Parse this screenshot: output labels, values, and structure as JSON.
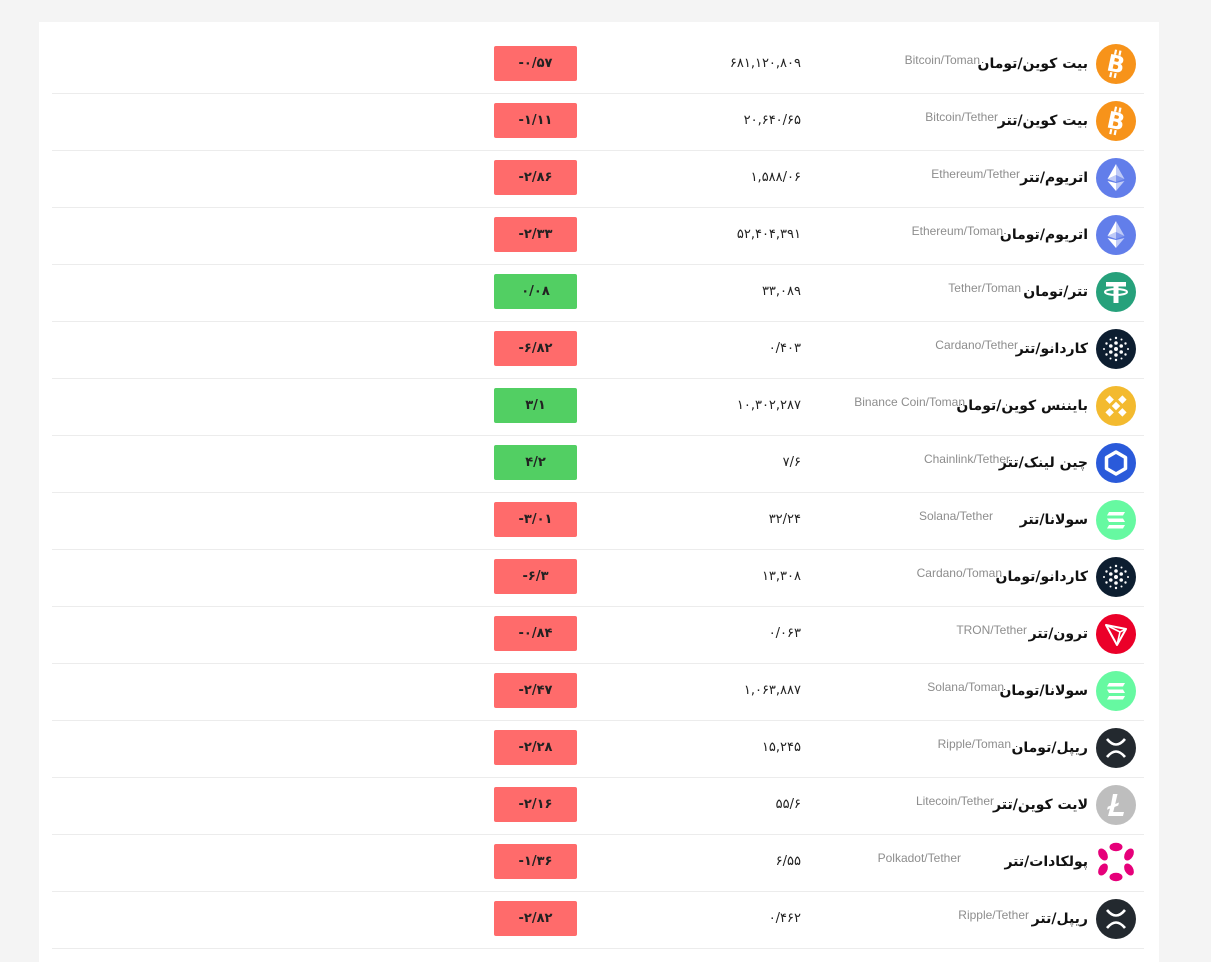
{
  "colors": {
    "negative": "#ff6b6b",
    "positive": "#52cf63"
  },
  "rows": [
    {
      "name_fa": "بیت کوین/تومان",
      "name_en": "Bitcoin/Toman",
      "price": "۶۸۱,۱۲۰,۸۰۹",
      "change": "-۰/۵۷",
      "direction": "down",
      "icon": "bitcoin-icon"
    },
    {
      "name_fa": "بیت کوین/تتر",
      "name_en": "Bitcoin/Tether",
      "price": "۲۰,۶۴۰/۶۵",
      "change": "-۱/۱۱",
      "direction": "down",
      "icon": "bitcoin-icon"
    },
    {
      "name_fa": "اتریوم/تتر",
      "name_en": "Ethereum/Tether",
      "price": "۱,۵۸۸/۰۶",
      "change": "-۲/۸۶",
      "direction": "down",
      "icon": "ethereum-icon"
    },
    {
      "name_fa": "اتریوم/تومان",
      "name_en": "Ethereum/Toman",
      "price": "۵۲,۴۰۴,۳۹۱",
      "change": "-۲/۳۳",
      "direction": "down",
      "icon": "ethereum-icon"
    },
    {
      "name_fa": "تتر/تومان",
      "name_en": "Tether/Toman",
      "price": "۳۳,۰۸۹",
      "change": "۰/۰۸",
      "direction": "up",
      "icon": "tether-icon"
    },
    {
      "name_fa": "کاردانو/تتر",
      "name_en": "Cardano/Tether",
      "price": "۰/۴۰۳",
      "change": "-۶/۸۲",
      "direction": "down",
      "icon": "cardano-icon"
    },
    {
      "name_fa": "بایننس کوین/تومان",
      "name_en": "Binance Coin/Toman",
      "price": "۱۰,۳۰۲,۲۸۷",
      "change": "۳/۱",
      "direction": "up",
      "icon": "binance-coin-icon"
    },
    {
      "name_fa": "چین لینک/تتر",
      "name_en": "Chainlink/Tether",
      "price": "۷/۶",
      "change": "۴/۲",
      "direction": "up",
      "icon": "chainlink-icon"
    },
    {
      "name_fa": "سولانا/تتر",
      "name_en": "Solana/Tether",
      "price": "۳۲/۲۴",
      "change": "-۳/۰۱",
      "direction": "down",
      "icon": "solana-icon"
    },
    {
      "name_fa": "کاردانو/تومان",
      "name_en": "Cardano/Toman",
      "price": "۱۳,۳۰۸",
      "change": "-۶/۳",
      "direction": "down",
      "icon": "cardano-icon"
    },
    {
      "name_fa": "ترون/تتر",
      "name_en": "TRON/Tether",
      "price": "۰/۰۶۳",
      "change": "-۰/۸۴",
      "direction": "down",
      "icon": "tron-icon"
    },
    {
      "name_fa": "سولانا/تومان",
      "name_en": "Solana/Toman",
      "price": "۱,۰۶۳,۸۸۷",
      "change": "-۲/۴۷",
      "direction": "down",
      "icon": "solana-icon"
    },
    {
      "name_fa": "ریپل/تومان",
      "name_en": "Ripple/Toman",
      "price": "۱۵,۲۴۵",
      "change": "-۲/۲۸",
      "direction": "down",
      "icon": "ripple-icon"
    },
    {
      "name_fa": "لایت کوین/تتر",
      "name_en": "Litecoin/Tether",
      "price": "۵۵/۶",
      "change": "-۲/۱۶",
      "direction": "down",
      "icon": "litecoin-icon"
    },
    {
      "name_fa": "پولکادات/تتر",
      "name_en": "Polkadot/Tether",
      "price": "۶/۵۵",
      "change": "-۱/۳۶",
      "direction": "down",
      "icon": "polkadot-icon"
    },
    {
      "name_fa": "ریپل/تتر",
      "name_en": "Ripple/Tether",
      "price": "۰/۴۶۲",
      "change": "-۲/۸۲",
      "direction": "down",
      "icon": "ripple-icon"
    }
  ]
}
